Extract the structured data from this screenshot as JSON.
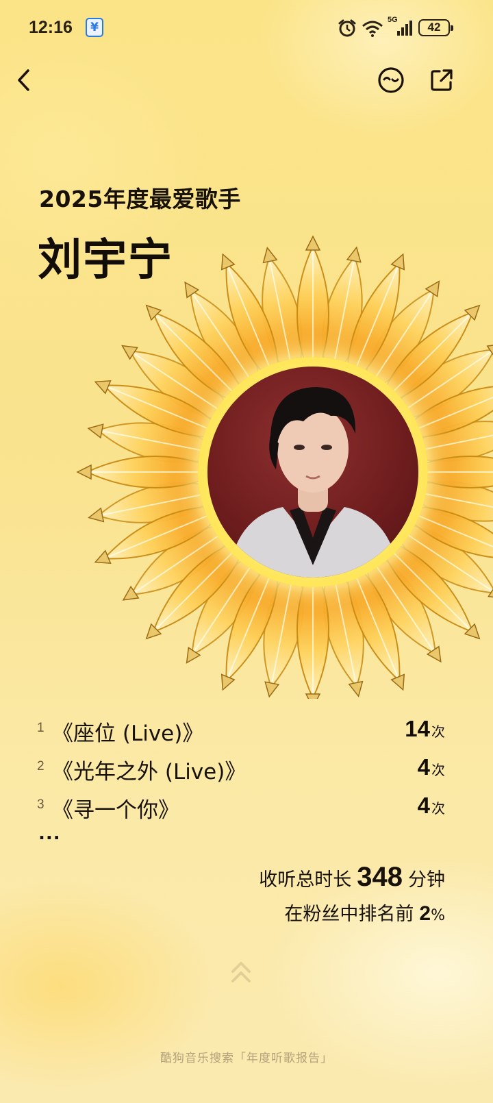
{
  "status_bar": {
    "time": "12:16",
    "app_badge": "씜",
    "network": "5G",
    "battery": "42"
  },
  "header": {
    "back_icon": "chevron-left-icon",
    "mood_icon": "face-icon",
    "share_icon": "share-icon"
  },
  "report": {
    "subtitle": "2025年度最爱歌手",
    "artist": "刘宇宁"
  },
  "songs": [
    {
      "rank": "1",
      "title": "《座位 (Live)》",
      "plays": "14",
      "unit": "次"
    },
    {
      "rank": "2",
      "title": "《光年之外 (Live)》",
      "plays": "4",
      "unit": "次"
    },
    {
      "rank": "3",
      "title": "《寻一个你》",
      "plays": "4",
      "unit": "次"
    }
  ],
  "more": "...",
  "stats": {
    "listen_label": "收听总时长",
    "listen_value": "348",
    "listen_unit": "分钟",
    "rank_label": "在粉丝中排名前",
    "rank_value": "2",
    "rank_unit": "%"
  },
  "footer": "酷狗音乐搜索「年度听歌报告」",
  "colors": {
    "background": "#fae38e",
    "petal": "#f4a21a",
    "ring": "#ffe65a",
    "text": "#17110a"
  }
}
